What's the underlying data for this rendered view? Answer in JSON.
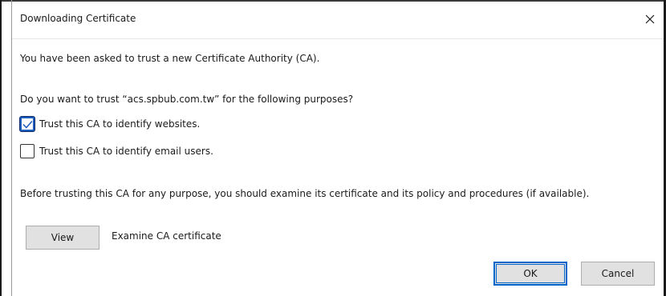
{
  "window": {
    "title": "Downloading Certificate",
    "close_icon": "close-icon"
  },
  "body": {
    "intro": "You have been asked to trust a new Certificate Authority (CA).",
    "question": "Do you want to trust “acs.spbub.com.tw” for the following purposes?",
    "options": [
      {
        "label": "Trust this CA to identify websites.",
        "checked": true
      },
      {
        "label": "Trust this CA to identify email users.",
        "checked": false
      }
    ],
    "advice": "Before trusting this CA for any purpose, you should examine its certificate and its policy and procedures (if available).",
    "view_button": "View",
    "view_description": "Examine CA certificate"
  },
  "footer": {
    "ok_label": "OK",
    "cancel_label": "Cancel"
  },
  "colors": {
    "accent": "#0066cc",
    "checkbox_accent": "#1f5fbf",
    "button_bg": "#e1e1e1"
  }
}
